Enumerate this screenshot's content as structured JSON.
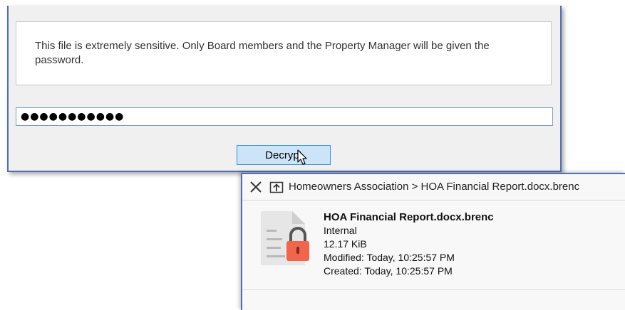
{
  "dialog": {
    "message": "This file is extremely sensitive. Only Board members and the Property Manager will be given the password.",
    "password_value": "●●●●●●●●●●●",
    "decrypt_label": "Decrypt"
  },
  "panel": {
    "breadcrumb": "Homeowners Association > HOA Financial Report.docx.brenc",
    "file": {
      "name": "HOA Financial Report.docx.brenc",
      "classification": "Internal",
      "size": "12.17 KiB",
      "modified": "Modified: Today, 10:25:57 PM",
      "created": "Created: Today, 10:25:57 PM"
    }
  },
  "colors": {
    "accent_border": "#4f6fb6",
    "button_bg": "#cce4f7",
    "lock_color": "#f0654c"
  },
  "icons": {
    "close": "close-icon",
    "open": "open-in-explorer-icon",
    "file": "encrypted-file-icon",
    "lock": "lock-icon",
    "cursor": "mouse-pointer-icon"
  }
}
